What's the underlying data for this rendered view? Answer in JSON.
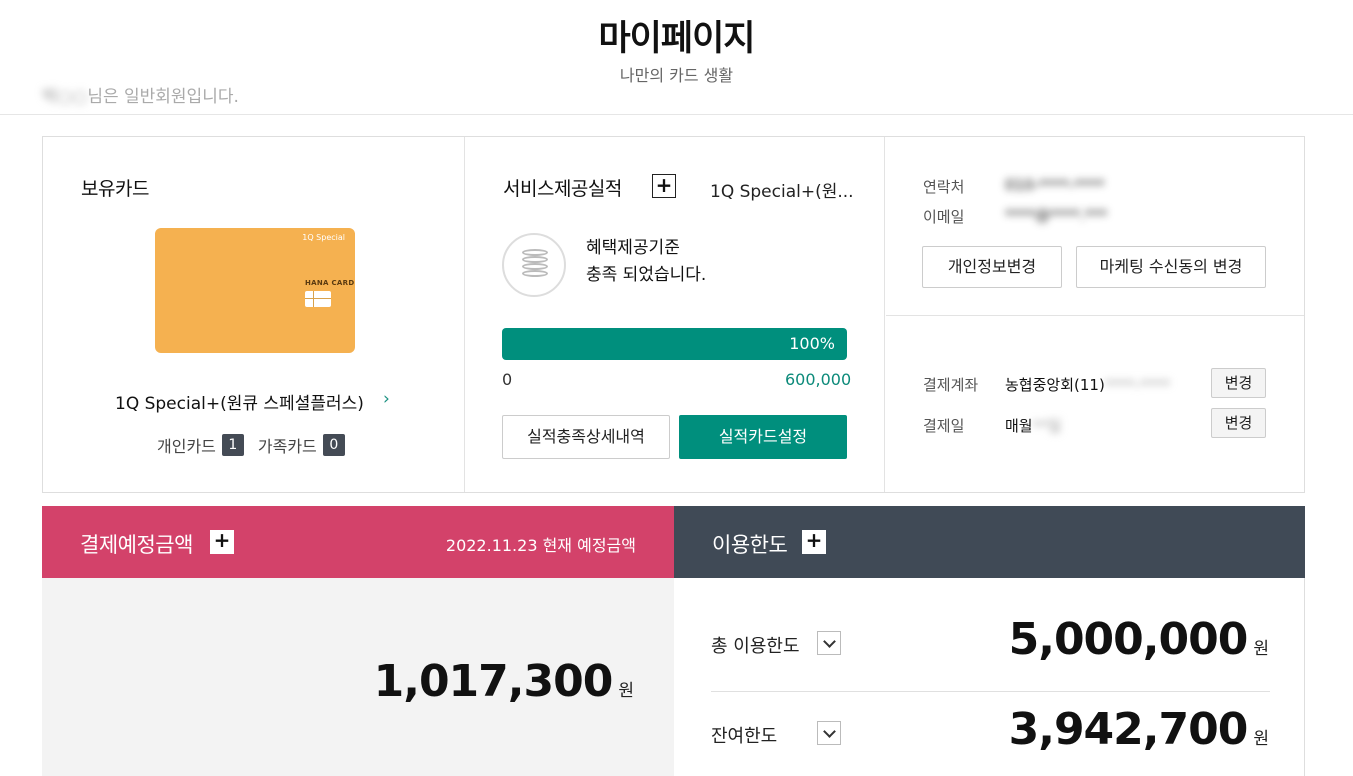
{
  "page": {
    "title": "마이페이지",
    "subtitle": "나만의 카드 생활"
  },
  "member": {
    "name_masked": "박○○",
    "grade_text": "님은 일반회원입니다."
  },
  "holding_cards": {
    "heading": "보유카드",
    "card_brand_text": "1Q Special",
    "card_issuer_text": "HANA CARD",
    "card_name": "1Q Special+(원큐 스페셜플러스)",
    "personal_label": "개인카드",
    "personal_count": "1",
    "family_label": "가족카드",
    "family_count": "0"
  },
  "performance": {
    "heading": "서비스제공실적",
    "plus": "+",
    "card_name_truncated": "1Q Special+(원...",
    "benefit_line1": "혜택제공기준",
    "benefit_line2": "충족 되었습니다.",
    "progress_percent": 100,
    "progress_label": "100%",
    "min_label": "0",
    "max_label": "600,000",
    "detail_button": "실적충족상세내역",
    "setting_button": "실적카드설정"
  },
  "contact": {
    "phone_label": "연락처",
    "phone_value": "010-****-****",
    "email_label": "이메일",
    "email_value": "****@****.***",
    "edit_info_button": "개인정보변경",
    "marketing_button": "마케팅 수신동의 변경"
  },
  "payment": {
    "account_label": "결제계좌",
    "account_value": "농협중앙회(11)",
    "account_masked": "****-****",
    "account_change": "변경",
    "date_label": "결제일",
    "date_value_prefix": "매월",
    "date_value_masked": "**일",
    "date_change": "변경"
  },
  "scheduled": {
    "heading": "결제예정금액",
    "plus": "+",
    "date_text": "2022.11.23 현재 예정금액",
    "amount": "1,017,300",
    "unit": "원"
  },
  "limit": {
    "heading": "이용한도",
    "plus": "+",
    "total_label": "총 이용한도",
    "total_amount": "5,000,000",
    "remain_label": "잔여한도",
    "remain_amount": "3,942,700",
    "unit": "원"
  },
  "colors": {
    "accent_green": "#008f7d",
    "payment_header": "#d3426a",
    "limit_header": "#404a56",
    "card_orange": "#f5b150"
  }
}
